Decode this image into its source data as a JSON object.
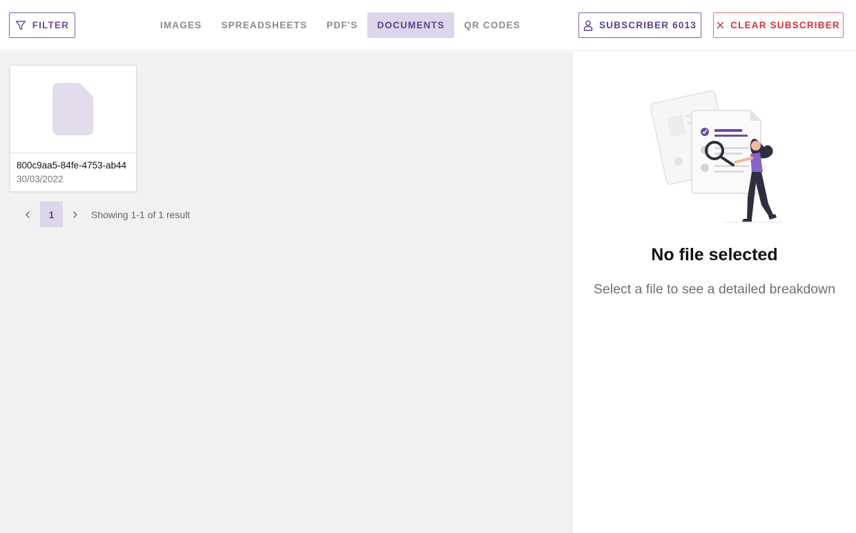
{
  "header": {
    "filter_label": "FILTER",
    "tabs": [
      {
        "label": "IMAGES",
        "active": false
      },
      {
        "label": "SPREADSHEETS",
        "active": false
      },
      {
        "label": "PDF'S",
        "active": false
      },
      {
        "label": "DOCUMENTS",
        "active": true
      },
      {
        "label": "QR CODES",
        "active": false
      }
    ],
    "subscriber_label": "SUBSCRIBER 6013",
    "clear_label": "CLEAR SUBSCRIBER"
  },
  "files": [
    {
      "name": "800c9aa5-84fe-4753-ab44",
      "date": "30/03/2022",
      "icon": "document-icon"
    }
  ],
  "pagination": {
    "current_page": "1",
    "showing_text": "Showing 1-1 of 1 result"
  },
  "detail": {
    "title": "No file selected",
    "subtitle": "Select a file to see a detailed breakdown"
  },
  "colors": {
    "accent": "#6b4aa0",
    "accent_light": "#dcd6ea",
    "danger": "#d6303f",
    "panel_bg": "#f1f1f1"
  }
}
